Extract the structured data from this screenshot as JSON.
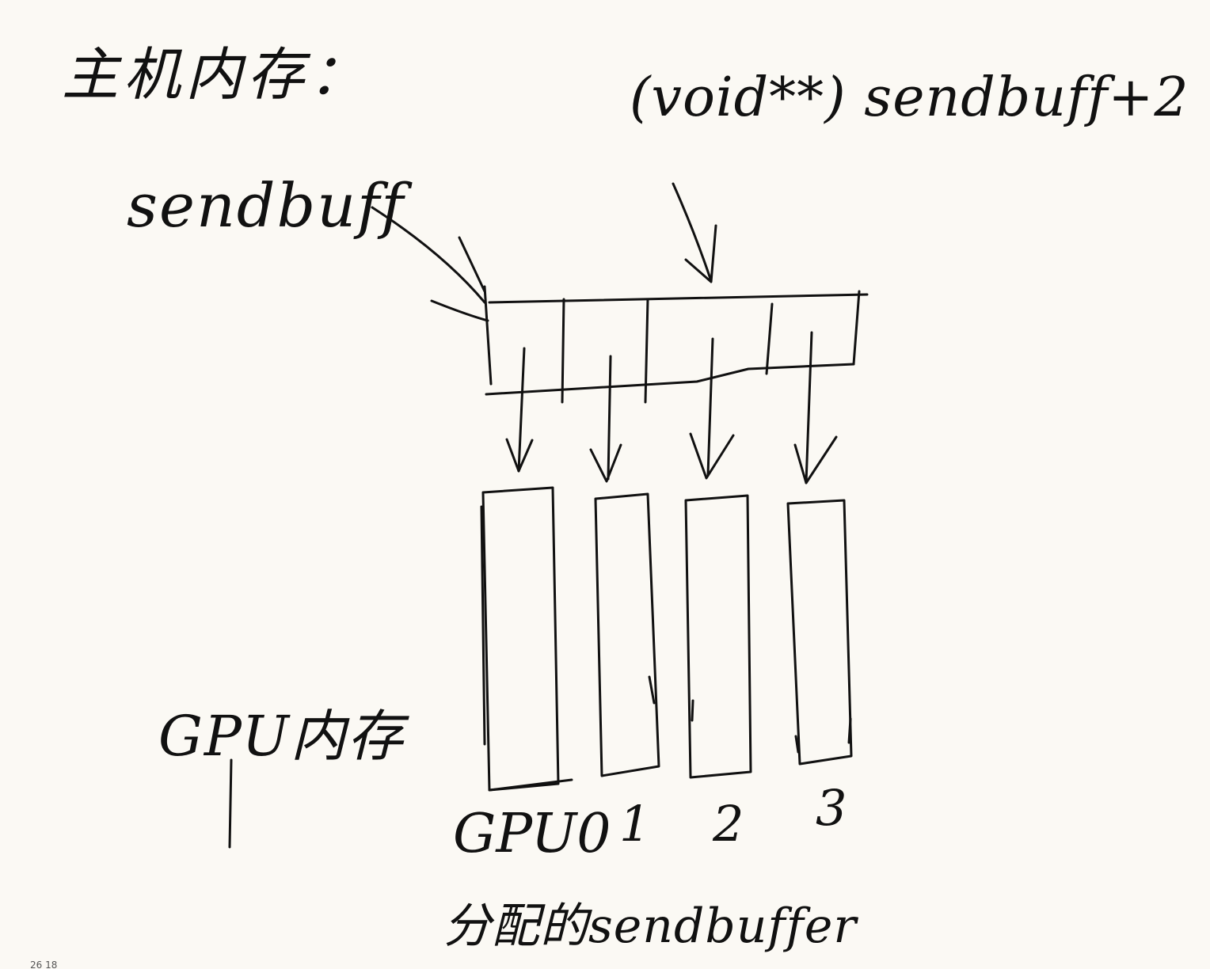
{
  "title": "主机内存：",
  "pointer_labels": {
    "base": "sendbuff",
    "offset": "(void**) sendbuff+2"
  },
  "gpu_memory_label": "GPU内存",
  "gpu_labels": [
    "GPU0",
    "1",
    "2",
    "3"
  ],
  "caption": "分配的sendbuffer",
  "footer": {
    "page_indicator": "26     18"
  },
  "colors": {
    "background": "#fbf9f4",
    "ink": "#111111"
  }
}
